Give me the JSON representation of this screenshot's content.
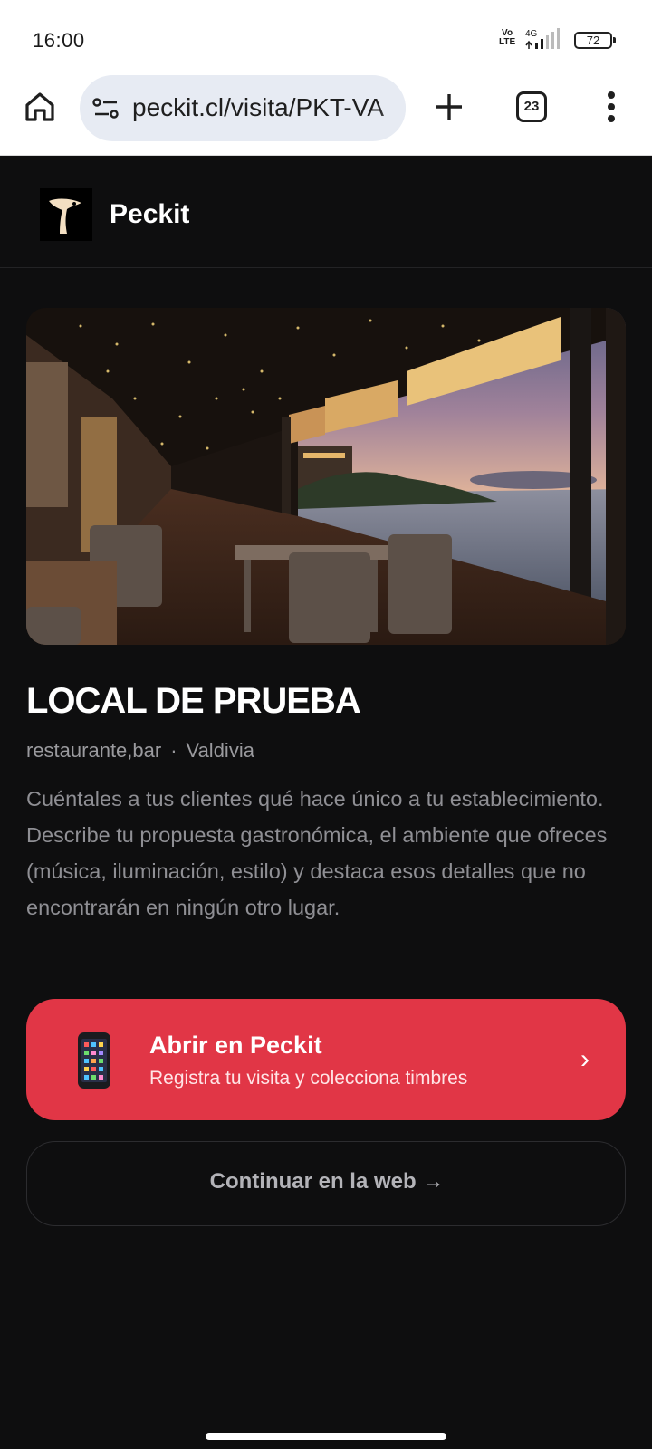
{
  "status_bar": {
    "time": "16:00",
    "network_top": "Vo",
    "network_bottom": "LTE",
    "network_gen": "4G",
    "battery": "72"
  },
  "browser": {
    "url": "peckit.cl/visita/PKT-VA",
    "tab_count": "23"
  },
  "app": {
    "name": "Peckit"
  },
  "venue": {
    "name": "LOCAL DE PRUEBA",
    "categories": "restaurante,bar",
    "separator": "·",
    "city": "Valdivia",
    "description": "Cuéntales a tus clientes qué hace único a tu establecimiento. Describe tu propuesta gastronómica, el ambiente que ofreces (música, iluminación, estilo) y destaca esos detalles que no encontrarán en ningún otro lugar."
  },
  "cta": {
    "open_title": "Abrir en Peckit",
    "open_subtitle": "Registra tu visita y colecciona timbres",
    "open_chevron": "›",
    "continue_label": "Continuar en la web →"
  },
  "colors": {
    "accent": "#e13646",
    "background": "#0e0e0f",
    "muted_text": "#8f8f94"
  }
}
